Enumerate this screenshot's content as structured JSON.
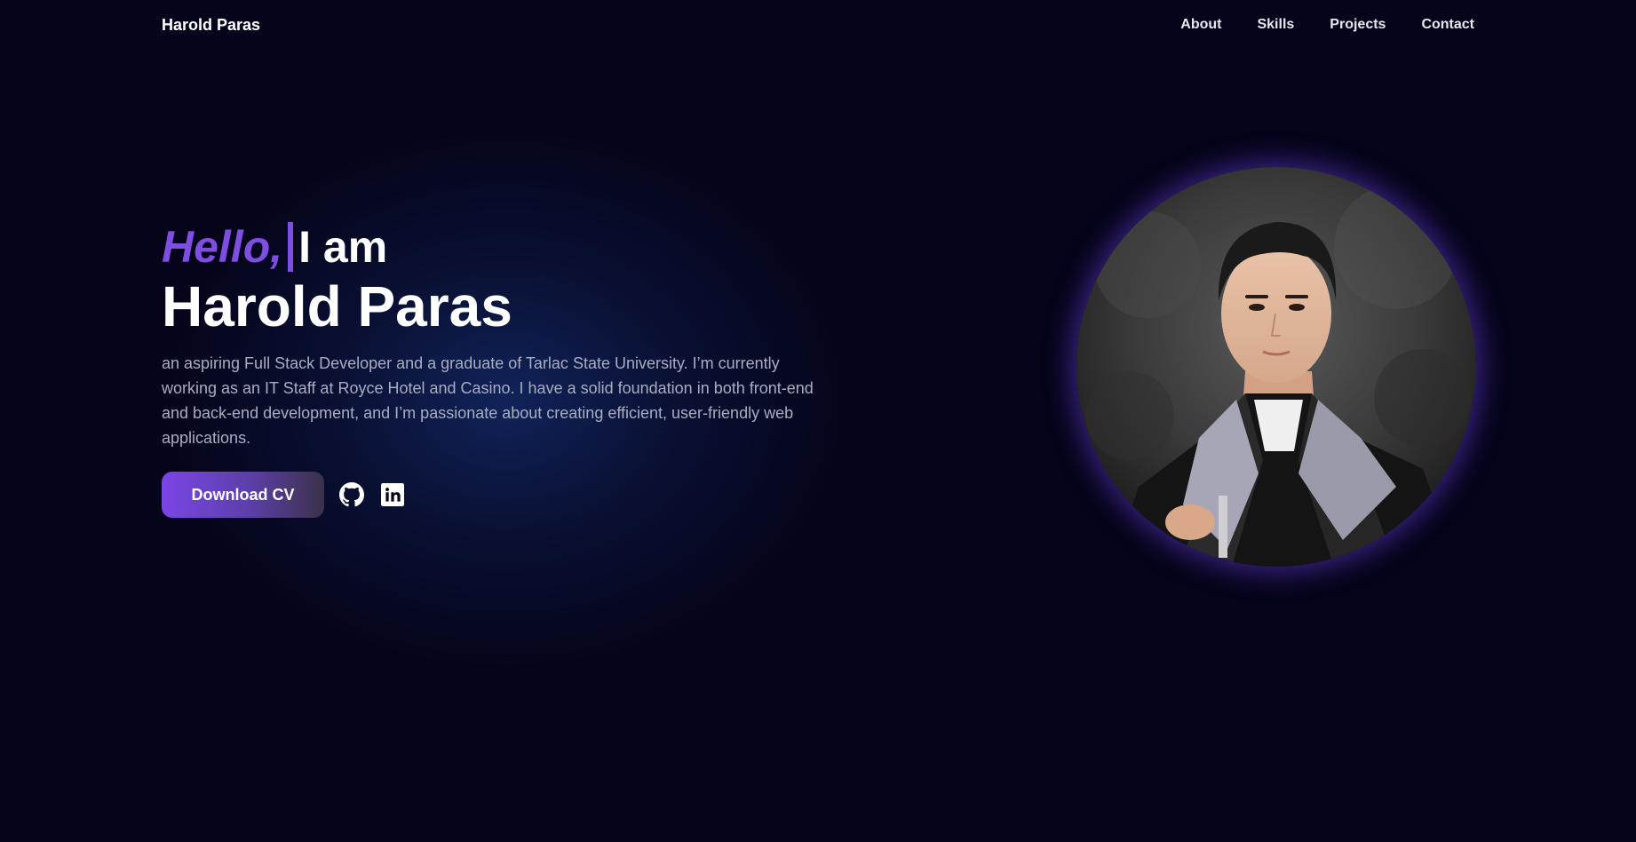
{
  "nav": {
    "brand": "Harold Paras",
    "links": [
      "About",
      "Skills",
      "Projects",
      "Contact"
    ]
  },
  "hero": {
    "hello": "Hello,",
    "iam": "I am",
    "name": "Harold Paras",
    "description": "an aspiring Full Stack Developer and a graduate of Tarlac State University. I’m currently working as an IT Staff at Royce Hotel and Casino. I have a solid foundation in both front-end and back-end development, and I’m passionate about creating efficient, user-friendly web applications.",
    "cv_button": "Download CV",
    "socials": [
      "github-icon",
      "linkedin-icon"
    ]
  },
  "colors": {
    "background": "#05041a",
    "accent": "#7d4ee0",
    "text": "#ffffff",
    "muted": "#a9adc2"
  }
}
